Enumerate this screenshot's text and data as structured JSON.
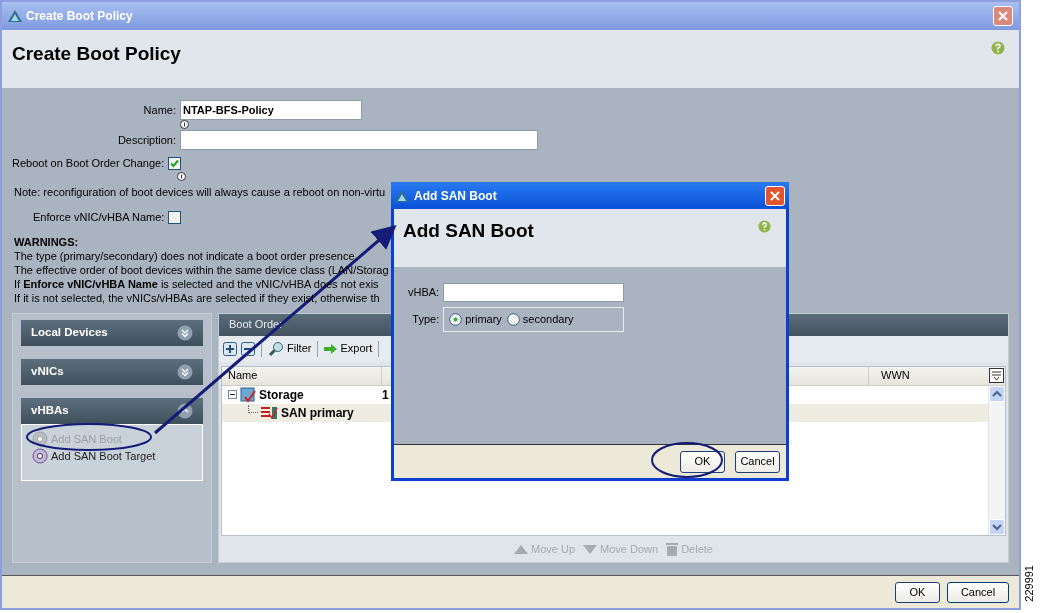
{
  "window": {
    "title": "Create Boot Policy"
  },
  "header": {
    "title": "Create Boot Policy"
  },
  "form": {
    "name_label": "Name:",
    "name_value": "NTAP-BFS-Policy",
    "description_label": "Description:",
    "reboot_label": "Reboot on Boot Order Change:",
    "reboot_checked": true,
    "note": "Note: reconfiguration of boot devices will always cause a reboot on non-virtu",
    "enforce_label": "Enforce vNIC/vHBA Name:",
    "enforce_checked": false
  },
  "warnings": {
    "heading": "WARNINGS:",
    "lines": [
      "The type (primary/secondary) does not indicate a boot order presence.",
      "The effective order of boot devices within the same device class (LAN/Storag",
      "If **Enforce vNIC/vHBA Name** is selected and the vNIC/vHBA does not exis",
      "If it is not selected, the vNICs/vHBAs are selected if they exist, otherwise th"
    ]
  },
  "accordion": [
    {
      "label": "Local Devices",
      "expanded": false
    },
    {
      "label": "vNICs",
      "expanded": false
    },
    {
      "label": "vHBAs",
      "expanded": true,
      "items": [
        {
          "label": "Add SAN Boot",
          "disabled": true
        },
        {
          "label": "Add SAN Boot Target",
          "disabled": false
        }
      ]
    }
  ],
  "boot_order": {
    "title": "Boot Order",
    "toolbar": [
      {
        "kind": "add"
      },
      {
        "kind": "remove"
      },
      {
        "kind": "filter",
        "label": "Filter"
      },
      {
        "kind": "export",
        "label": "Export"
      }
    ],
    "columns": [
      {
        "label": "Name"
      },
      {
        "label": "WWN"
      }
    ],
    "rows": [
      {
        "name": "Storage",
        "order": "1",
        "kind": "storage",
        "expanded": true,
        "selected": false,
        "children": [
          {
            "name": "SAN primary",
            "kind": "san",
            "selected": true
          }
        ]
      }
    ],
    "actions": [
      {
        "kind": "up",
        "label": "Move Up",
        "disabled": true
      },
      {
        "kind": "down",
        "label": "Move Down",
        "disabled": true
      },
      {
        "kind": "delete",
        "label": "Delete",
        "disabled": true
      }
    ]
  },
  "dialog": {
    "title": "Add SAN Boot",
    "header": "Add SAN Boot",
    "vhba_label": "vHBA:",
    "type_label": "Type:",
    "options": [
      {
        "label": "primary",
        "selected": true
      },
      {
        "label": "secondary",
        "selected": false
      }
    ],
    "buttons": [
      "OK",
      "Cancel"
    ]
  },
  "footer": {
    "buttons": [
      "OK",
      "Cancel"
    ]
  },
  "figure_number": "229991"
}
